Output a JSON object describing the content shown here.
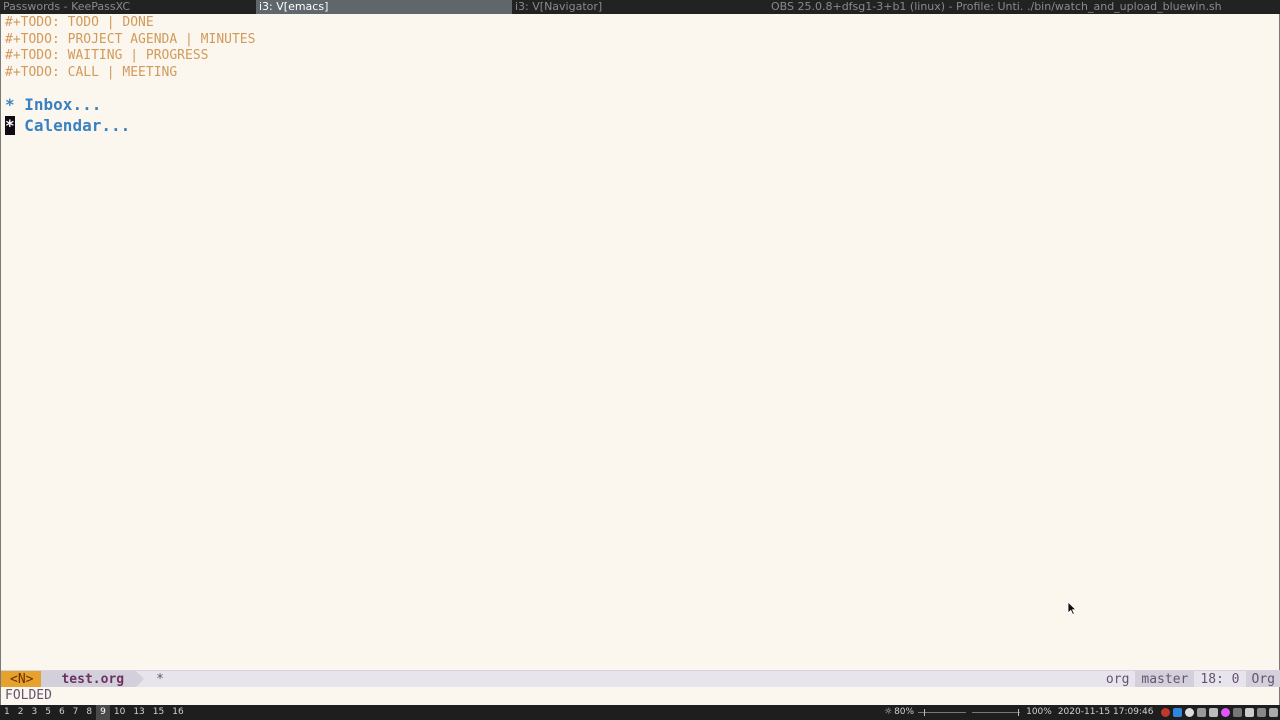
{
  "titlebar": {
    "tabs": [
      {
        "label": "Passwords - KeePassXC",
        "active": false
      },
      {
        "label": "i3: V[emacs]",
        "active": true
      },
      {
        "label": "i3: V[Navigator]",
        "active": false
      },
      {
        "label": "OBS 25.0.8+dfsg1-3+b1 (linux) - Profile: Unti...",
        "active": false
      },
      {
        "label": "./bin/watch_and_upload_bluewin.sh",
        "active": false
      }
    ]
  },
  "buffer": {
    "keyword_lines": [
      "#+TODO: TODO | DONE",
      "#+TODO: PROJECT AGENDA | MINUTES",
      "#+TODO: WAITING | PROGRESS",
      "#+TODO: CALL | MEETING"
    ],
    "headings": [
      {
        "star": "*",
        "text": " Inbox..."
      },
      {
        "star": "*",
        "text": " Calendar..."
      }
    ]
  },
  "modeline": {
    "state": "<N>",
    "filename": "test.org",
    "modified": "*",
    "major_mode": "org",
    "branch": "master",
    "position": "18: 0",
    "mode_name": "Org"
  },
  "echo": {
    "message": "FOLDED"
  },
  "i3bar": {
    "workspaces": [
      "1",
      "2",
      "3",
      "5",
      "6",
      "7",
      "8",
      "9",
      "10",
      "13",
      "15",
      "16"
    ],
    "focused_workspace": "9",
    "brightness": "80%",
    "volume": "100%",
    "datetime": "2020-11-15 17:09:46"
  },
  "colors": {
    "background": "#fbf7ef",
    "keyword": "#d29a5a",
    "heading": "#3a81c3",
    "state_bg": "#e6a22d"
  }
}
